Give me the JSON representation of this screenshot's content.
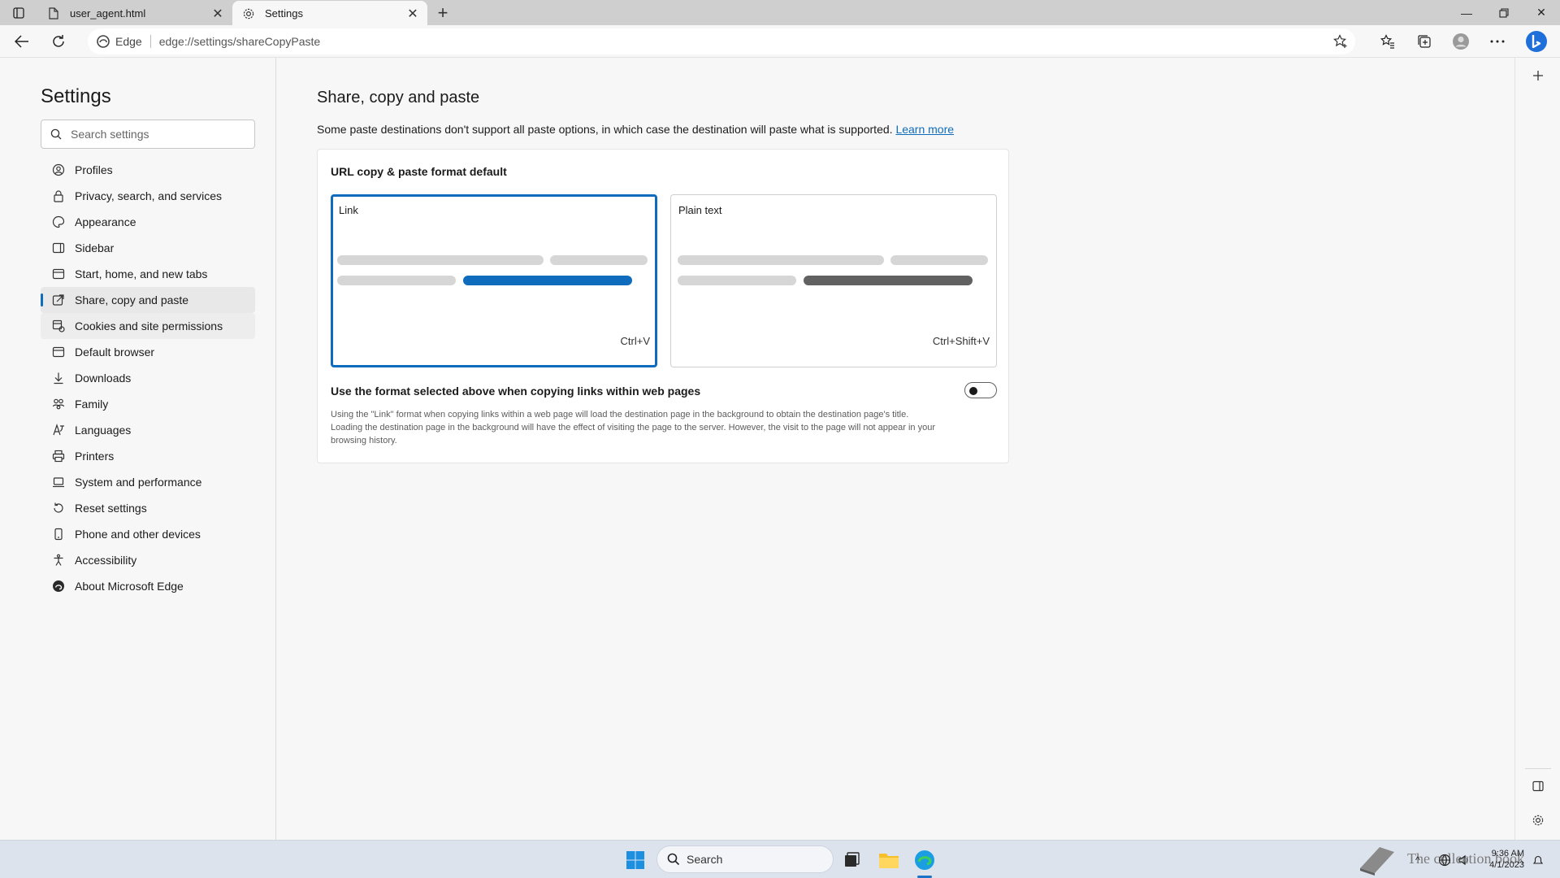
{
  "browser": {
    "tabs": [
      {
        "title": "user_agent.html",
        "active": false
      },
      {
        "title": "Settings",
        "active": true
      }
    ],
    "address": {
      "site_label": "Edge",
      "url": "edge://settings/shareCopyPaste"
    }
  },
  "settings_nav": {
    "title": "Settings",
    "search_placeholder": "Search settings",
    "items": [
      {
        "label": "Profiles",
        "icon": "profile-icon"
      },
      {
        "label": "Privacy, search, and services",
        "icon": "lock-icon"
      },
      {
        "label": "Appearance",
        "icon": "appearance-icon"
      },
      {
        "label": "Sidebar",
        "icon": "sidebar-icon"
      },
      {
        "label": "Start, home, and new tabs",
        "icon": "home-tabs-icon"
      },
      {
        "label": "Share, copy and paste",
        "icon": "share-icon",
        "selected": true
      },
      {
        "label": "Cookies and site permissions",
        "icon": "cookies-icon"
      },
      {
        "label": "Default browser",
        "icon": "browser-icon"
      },
      {
        "label": "Downloads",
        "icon": "download-icon"
      },
      {
        "label": "Family",
        "icon": "family-icon"
      },
      {
        "label": "Languages",
        "icon": "languages-icon"
      },
      {
        "label": "Printers",
        "icon": "printer-icon"
      },
      {
        "label": "System and performance",
        "icon": "laptop-icon"
      },
      {
        "label": "Reset settings",
        "icon": "reset-icon"
      },
      {
        "label": "Phone and other devices",
        "icon": "phone-icon"
      },
      {
        "label": "Accessibility",
        "icon": "accessibility-icon"
      },
      {
        "label": "About Microsoft Edge",
        "icon": "edge-logo-icon"
      }
    ]
  },
  "main": {
    "title": "Share, copy and paste",
    "description": "Some paste destinations don't support all paste options, in which case the destination will paste what is supported.",
    "learn_more": "Learn more",
    "card": {
      "title": "URL copy & paste format default",
      "options": [
        {
          "label": "Link",
          "shortcut": "Ctrl+V",
          "selected": true
        },
        {
          "label": "Plain text",
          "shortcut": "Ctrl+Shift+V",
          "selected": false
        }
      ],
      "toggle_label": "Use the format selected above when copying links within web pages",
      "toggle_on": false,
      "help_line1": "Using the \"Link\" format when copying links within a web page will load the destination page in the background to obtain the destination page's title.",
      "help_line2": "Loading the destination page in the background will have the effect of visiting the page to the server. However, the visit to the page will not appear in your",
      "help_line3": "browsing history."
    }
  },
  "taskbar": {
    "search_label": "Search",
    "time": "9:36 AM",
    "date": "4/1/2023",
    "watermark": "The collection book"
  },
  "colors": {
    "accent": "#0f6cbd",
    "plain_bar": "#616161"
  }
}
